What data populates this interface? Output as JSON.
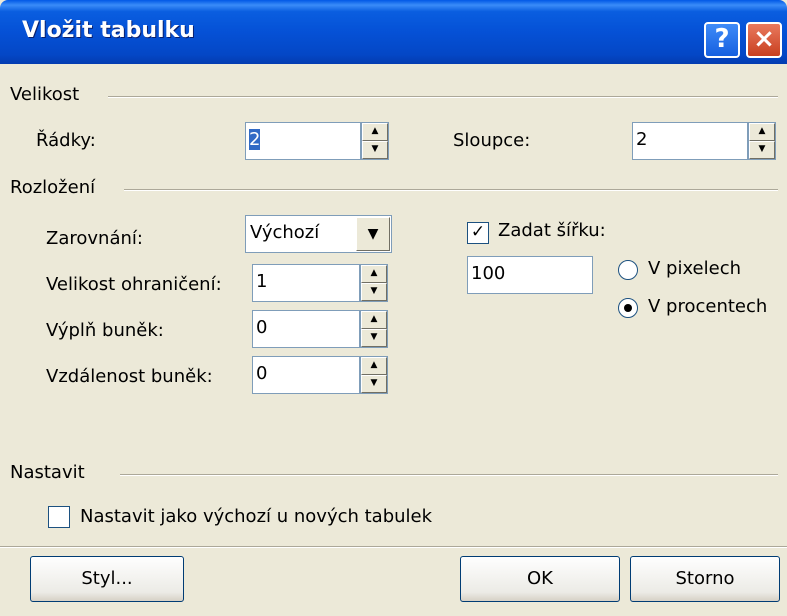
{
  "window": {
    "title": "Vložit tabulku",
    "help_label": "?",
    "close_label": "×"
  },
  "size_group": {
    "label": "Velikost",
    "rows_label": "Řádky:",
    "rows_value": "2",
    "cols_label": "Sloupce:",
    "cols_value": "2"
  },
  "layout_group": {
    "label": "Rozložení",
    "align_label": "Zarovnání:",
    "align_value": "Výchozí",
    "border_label": "Velikost ohraničení:",
    "border_value": "1",
    "padding_label": "Výplň buněk:",
    "padding_value": "0",
    "spacing_label": "Vzdálenost buněk:",
    "spacing_value": "0",
    "width_checkbox_label": "Zadat šířku:",
    "width_checked": true,
    "width_value": "100",
    "unit_pixels_label": "V pixelech",
    "unit_percent_label": "V procentech",
    "unit_selected": "percent"
  },
  "set_group": {
    "label": "Nastavit",
    "default_checkbox_label": "Nastavit jako výchozí u nových tabulek",
    "default_checked": false
  },
  "buttons": {
    "style_label": "Styl...",
    "ok_label": "OK",
    "cancel_label": "Storno"
  },
  "colors": {
    "titlebar": "#0551d6",
    "dialog_bg": "#ece9d8",
    "selection": "#316ac5"
  }
}
